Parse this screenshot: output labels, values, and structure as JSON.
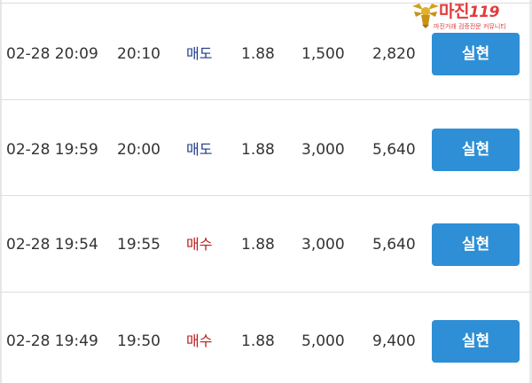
{
  "watermark": {
    "name": "마진",
    "suffix": "119",
    "tagline": "마진거래 검증전문 커뮤니티"
  },
  "trades": [
    {
      "time": "02-28 20:09",
      "exec_time": "20:10",
      "side": "매도",
      "side_type": "sell",
      "price": "1.88",
      "quantity": "1,500",
      "amount": "2,820",
      "action_label": "실현"
    },
    {
      "time": "02-28 19:59",
      "exec_time": "20:00",
      "side": "매도",
      "side_type": "sell",
      "price": "1.88",
      "quantity": "3,000",
      "amount": "5,640",
      "action_label": "실현"
    },
    {
      "time": "02-28 19:54",
      "exec_time": "19:55",
      "side": "매수",
      "side_type": "buy",
      "price": "1.88",
      "quantity": "3,000",
      "amount": "5,640",
      "action_label": "실현"
    },
    {
      "time": "02-28 19:49",
      "exec_time": "19:50",
      "side": "매수",
      "side_type": "buy",
      "price": "1.88",
      "quantity": "5,000",
      "amount": "9,400",
      "action_label": "실현"
    }
  ],
  "colors": {
    "sell": "#1f3a8a",
    "buy": "#b91c1c",
    "button": "#2e8fd6",
    "watermark": "#e23b3b"
  }
}
